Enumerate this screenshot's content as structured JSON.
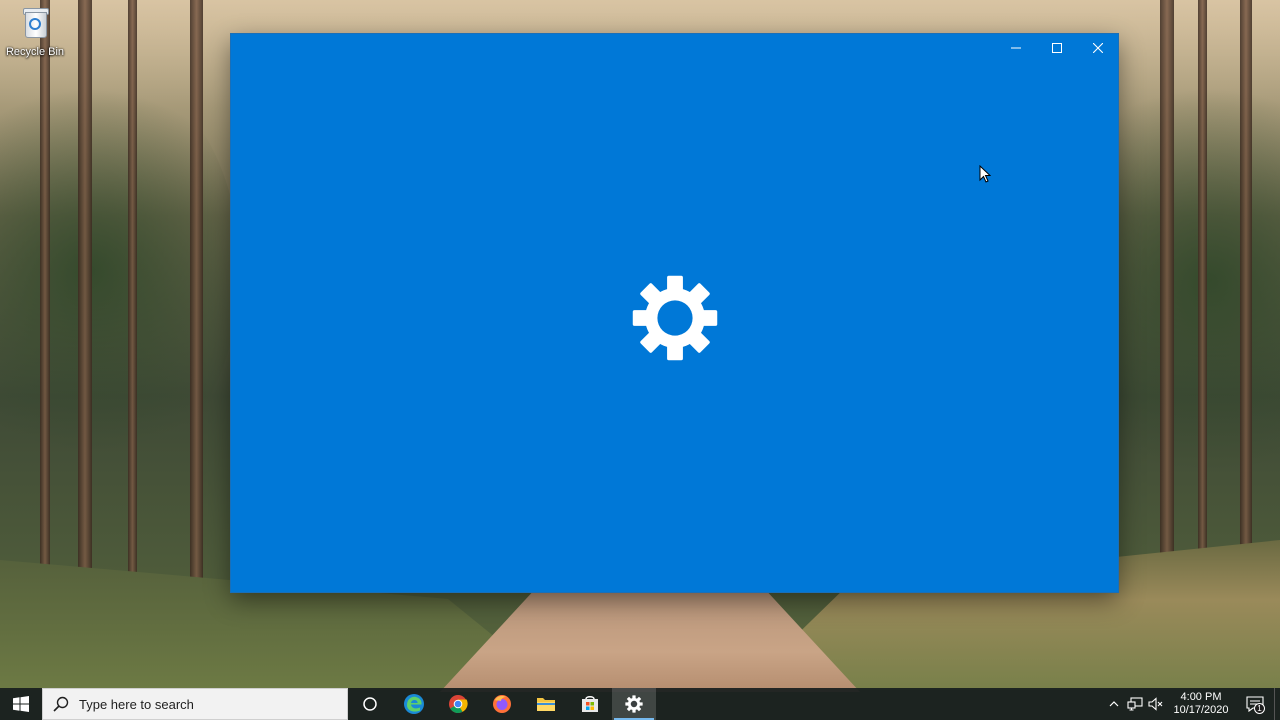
{
  "desktop": {
    "icons": [
      {
        "label": "Recycle Bin",
        "icon": "recycle-bin-icon"
      }
    ]
  },
  "window": {
    "app": "Settings",
    "splash_icon": "gear-icon",
    "background_color": "#0078d7",
    "caption_buttons": [
      {
        "name": "minimize",
        "icon": "minimize-icon"
      },
      {
        "name": "maximize",
        "icon": "maximize-icon"
      },
      {
        "name": "close",
        "icon": "close-icon"
      }
    ]
  },
  "taskbar": {
    "start_icon": "windows-logo-icon",
    "search_placeholder": "Type here to search",
    "pinned": [
      {
        "name": "cortana",
        "icon": "circle-icon",
        "active": false
      },
      {
        "name": "edge",
        "icon": "edge-icon",
        "active": false
      },
      {
        "name": "chrome",
        "icon": "chrome-icon",
        "active": false
      },
      {
        "name": "firefox",
        "icon": "firefox-icon",
        "active": false
      },
      {
        "name": "file-explorer",
        "icon": "folder-icon",
        "active": false
      },
      {
        "name": "store",
        "icon": "store-bag-icon",
        "active": false
      },
      {
        "name": "settings",
        "icon": "gear-icon",
        "active": true
      }
    ],
    "tray": {
      "icons": [
        "chevron-up-icon",
        "network-icon",
        "speaker-muted-icon"
      ],
      "time": "4:00 PM",
      "date": "10/17/2020",
      "notification_count": "1"
    },
    "accent_color": "#76b9ed"
  }
}
